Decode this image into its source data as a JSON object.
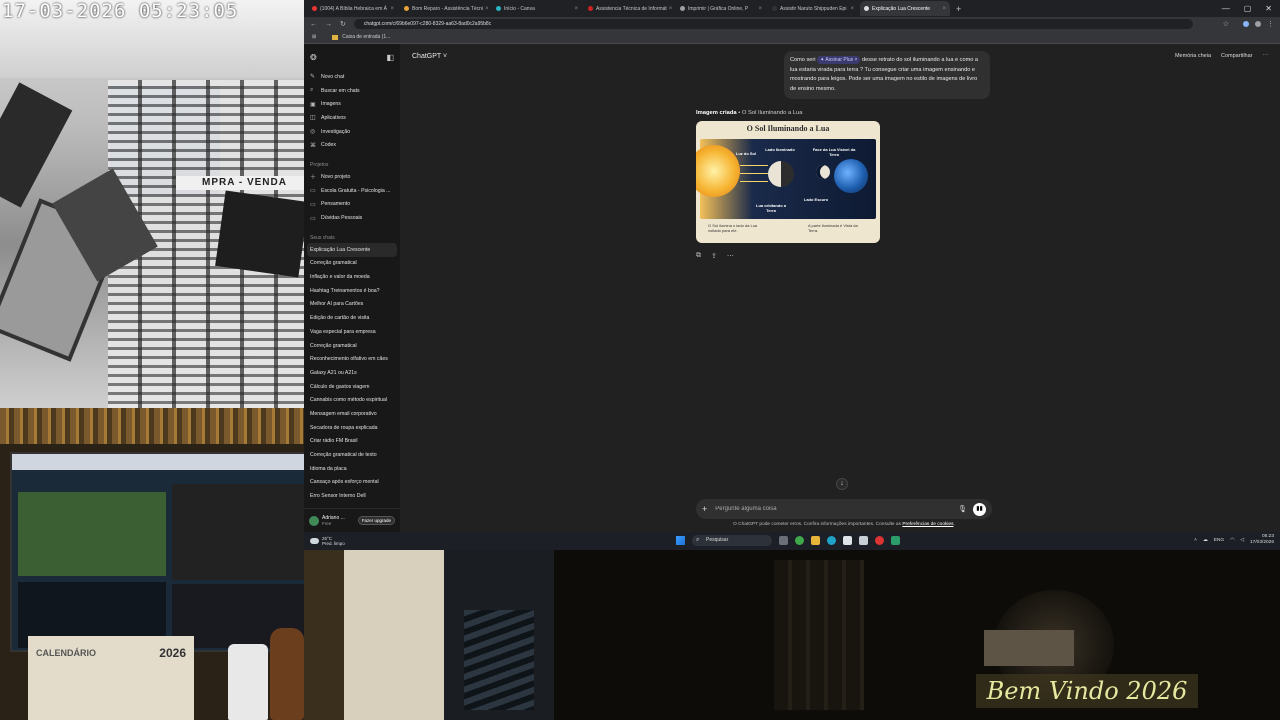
{
  "camera": {
    "timestamp": "17-03-2026 05:23:05",
    "garage_sign": "MPRA - VENDA",
    "calendar_year": "2026",
    "calendar_month": "CALENDÁRIO",
    "welcome_text": "Bem Vindo 2026"
  },
  "browser": {
    "tabs": [
      {
        "title": "(1004) A Bíblia Hebraica em Á"
      },
      {
        "title": "Bom Reparo - Assistência Técni"
      },
      {
        "title": "Início - Canva"
      },
      {
        "title": "Assistencia Técnica de Informát"
      },
      {
        "title": "Imprimir | Gráfica Online, P"
      },
      {
        "title": "Assistir Naruto Shippuden Epi"
      },
      {
        "title": "Explicação Lua Crescente",
        "active": true
      }
    ],
    "new_tab": "+",
    "url": "chatgpt.com/c/69b6e097-c280-8329-aa63-8ad0c2a95b8c",
    "bookmark": "Caixa de entrada (1..."
  },
  "sidebar": {
    "nav": [
      {
        "icon": "✎",
        "label": "Novo chat"
      },
      {
        "icon": "⌕",
        "label": "Buscar em chats"
      },
      {
        "icon": "▣",
        "label": "Imagens"
      },
      {
        "icon": "◫",
        "label": "Aplicativos"
      },
      {
        "icon": "◎",
        "label": "Investigação"
      },
      {
        "icon": "⌘",
        "label": "Codex"
      }
    ],
    "projects_title": "Projetos",
    "projects": [
      {
        "icon": "＋",
        "label": "Novo projeto"
      },
      {
        "icon": "▭",
        "label": "Escola Gratuita - Psicologia ..."
      },
      {
        "icon": "▭",
        "label": "Pensamento"
      },
      {
        "icon": "▭",
        "label": "Dúvidas Pessoais"
      }
    ],
    "chats_title": "Seus chats",
    "chats": [
      "Explicação Lua Crescente",
      "Correção gramatical",
      "Inflação e valor da moeda",
      "Hashtag Treinamentos é boa?",
      "Melhor AI para Cartões",
      "Edição de cartão de visita",
      "Vaga especial para empresa",
      "Correção gramatical",
      "Reconhecimento olfativo em cães",
      "Galaxy A21 ou A21s",
      "Cálculo de gastos viagem",
      "Cannabis como método espiritual",
      "Mensagem email corporativo",
      "Secadora de roupa explicada",
      "Criar rádio FM Brasil",
      "Correção gramatical de texto",
      "Idioma da placa",
      "Cansaço após esforço mental",
      "Erro Sensor Interno Dell"
    ],
    "user_name": "Adriano ...",
    "user_plan": "Free",
    "upgrade_label": "Fazer upgrade"
  },
  "main": {
    "model": "ChatGPT ˅",
    "memory_label": "Memória cheia",
    "share_label": "Compartilhar",
    "user_message_pre": "Como seri",
    "plus_chip": "✦ Assinar Plus ×",
    "user_message_post": "desse retrato do sol iluminando a lua e como a lua estaria virada para terra ? Tu consegue criar uma imagem ensinando e mostrando para leigos. Pode ser uma imagem no estilo de imagens de livro de ensino mesmo.",
    "image_caption_bold": "Imagem criada",
    "image_caption_rest": " • O Sol Iluminando a Lua",
    "image_title": "O Sol Iluminando a Lua",
    "image_labels": {
      "luz_sol": "Luz do Sol",
      "lado_iluminado": "Lado Iluminado",
      "face_lua": "Face da Lua Visível da Terra",
      "lado_escuro": "Lado Escuro",
      "lua_orbitando": "Lua orbitando a Terra",
      "caption_left": "O Sol ilumina o lado da Lua voltado para ele.",
      "caption_right": "A parte iluminada é Vista da Terra."
    },
    "actions": [
      "⧉",
      "⇪",
      "⋯"
    ],
    "scroll_down": "↓",
    "composer_placeholder": "Pergunte alguma coisa",
    "disclaimer_pre": "O ChatGPT pode cometer erros. Confira informações importantes. Consulte as ",
    "disclaimer_link": "Preferências de cookies",
    "disclaimer_post": "."
  },
  "taskbar": {
    "temp": "25°C",
    "weather": "Pred. limpo",
    "search": "Pesquisar",
    "lang": "ENG",
    "time": "05:23",
    "date": "17/03/2026"
  }
}
